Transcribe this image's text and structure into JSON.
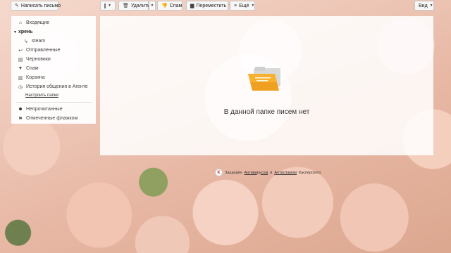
{
  "toolbar": {
    "compose_label": "Написать письмо",
    "delete_label": "Удалить",
    "spam_label": "Спам",
    "move_label": "Переместить",
    "more_label": "Ещё",
    "view_label": "Вид"
  },
  "sidebar": {
    "items": [
      {
        "label": "Входящие",
        "icon": "inbox-icon"
      },
      {
        "label": "хрень",
        "icon": "folder-open-icon"
      },
      {
        "label": "steam",
        "icon": "folder-sub-icon"
      },
      {
        "label": "Отправленные",
        "icon": "sent-icon"
      },
      {
        "label": "Черновики",
        "icon": "drafts-icon"
      },
      {
        "label": "Спам",
        "icon": "spam-icon"
      },
      {
        "label": "Корзина",
        "icon": "trash-icon"
      },
      {
        "label": "История общения в Агенте",
        "icon": "agent-history-icon"
      }
    ],
    "setup_label": "Настроить папки",
    "filters": [
      {
        "label": "Непрочитанные",
        "icon": "unread-dot-icon"
      },
      {
        "label": "Отмеченные флажком",
        "icon": "flag-icon"
      }
    ]
  },
  "content": {
    "empty_message": "В данной папке писем нет"
  },
  "footer": {
    "protected_prefix": "Защищён",
    "antivirus_label": "Антивирусом",
    "and_label": "и",
    "antispam_label": "Антиспамом",
    "vendor": "Касперского"
  },
  "colors": {
    "folder_orange": "#f0a020",
    "flag_red": "#d9532c"
  }
}
